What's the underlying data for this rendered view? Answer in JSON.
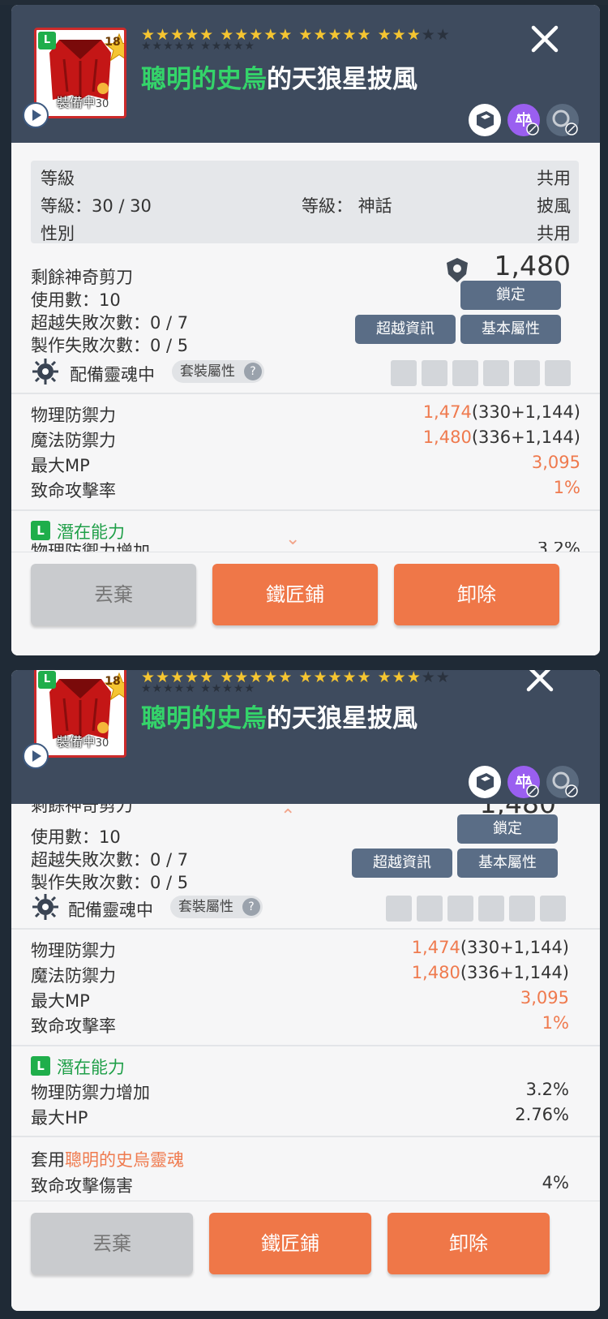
{
  "panels": [
    {
      "header": {
        "level_badge": "L",
        "star_level": "18",
        "equipped_label": "裝備中",
        "version_text": "30",
        "title_prefix": "聰明的史烏",
        "title_suffix": "的天狼星披風",
        "stars_filled": 17,
        "stars_total": 20,
        "icons": [
          "cube-icon",
          "balance-icon",
          "refresh-icon"
        ]
      },
      "info": {
        "level_label": "等級",
        "shared_label": "共用",
        "level_value": "等級：30 / 30",
        "grade_label": "等級： 神話",
        "type_label": "披風",
        "gender_label": "性別",
        "gender_value": "共用"
      },
      "scissors": {
        "remaining_label": "剩餘神奇剪刀",
        "uses": "使用數：10",
        "transcend_fail": "超越失敗次數：0 / 7",
        "craft_fail": "製作失敗次數：0 / 5",
        "power": "1,480",
        "lock_button": "鎖定",
        "transcend_info_button": "超越資訊",
        "base_stats_button": "基本屬性"
      },
      "soul": {
        "label": "配備靈魂中",
        "set_button": "套裝屬性",
        "help": "?"
      },
      "stats": [
        {
          "name": "物理防禦力",
          "value": "1,474",
          "detail": "(330+1,144)"
        },
        {
          "name": "魔法防禦力",
          "value": "1,480",
          "detail": "(336+1,144)"
        },
        {
          "name": "最大MP",
          "value": "3,095",
          "detail": ""
        },
        {
          "name": "致命攻擊率",
          "value": "1%",
          "detail": ""
        }
      ],
      "potential": {
        "badge": "L",
        "title": "潛在能力",
        "cut_row_name": "物理防禦力增加",
        "cut_row_value": "3.2%"
      },
      "buttons": {
        "discard": "丟棄",
        "smith": "鐵匠鋪",
        "unequip": "卸除"
      }
    },
    {
      "scissors_cut_label": "剩餘神奇剪刀",
      "soul_set": {
        "apply_label": "套用",
        "soul_name": "聰明的史烏靈魂",
        "stat_name": "致命攻擊傷害",
        "stat_value": "4%"
      },
      "potential_rows": [
        {
          "name": "物理防禦力增加",
          "value": "3.2%"
        },
        {
          "name": "最大HP",
          "value": "2.76%"
        }
      ]
    }
  ],
  "colors": {
    "header_bg": "#3e4b5e",
    "accent_orange": "#ef7748",
    "name_green": "#34d46a",
    "star_gold": "#f5c531"
  }
}
